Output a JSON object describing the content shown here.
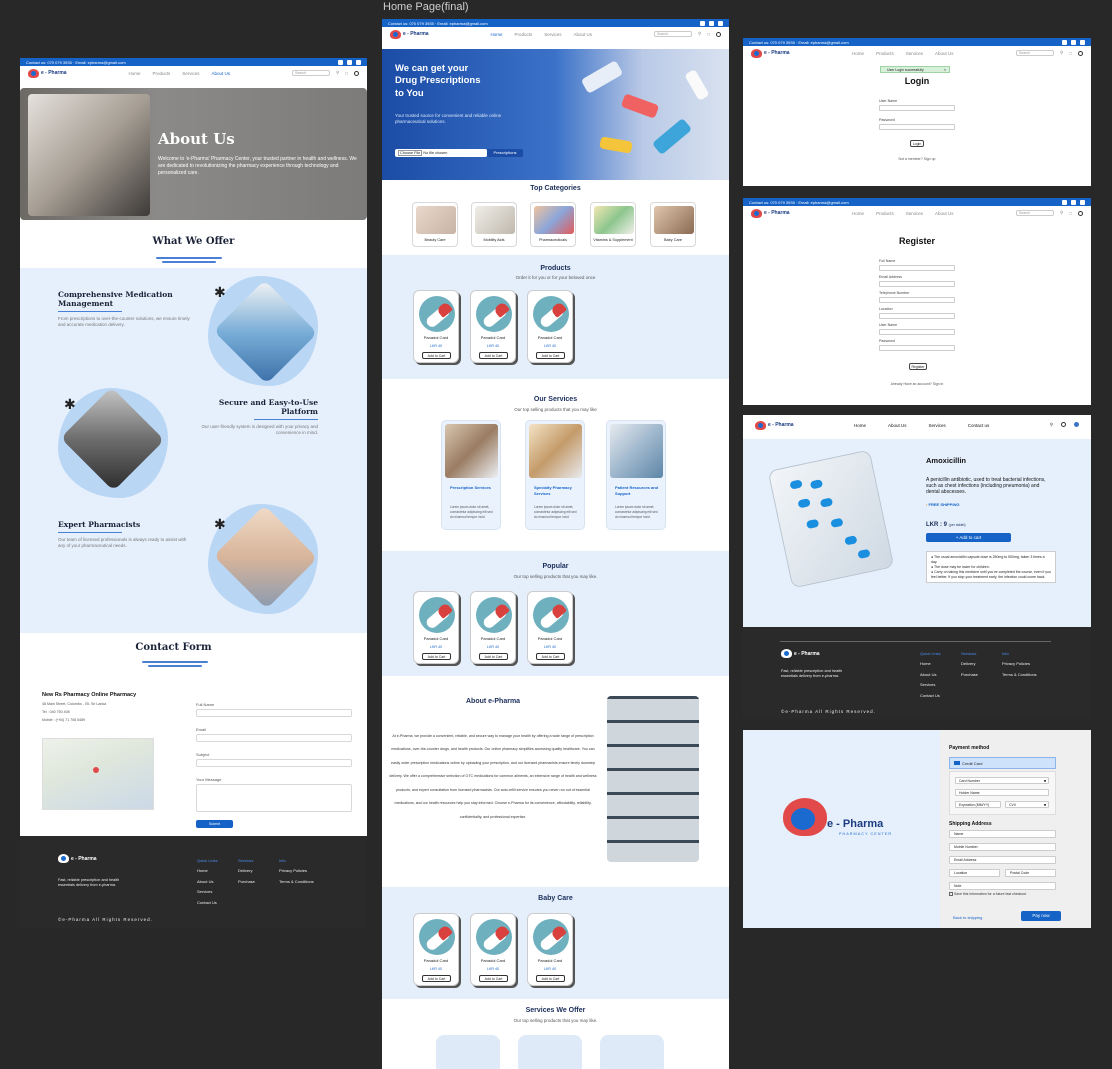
{
  "frame_title": "Home Page(final)",
  "topbar": {
    "contact": "Contact us: 070 079 3935 · Email: epharma@gmail.com"
  },
  "nav": {
    "home": "Home",
    "products": "Products",
    "services": "Services",
    "about": "About Us",
    "search_placeholder": "Search"
  },
  "brand": {
    "name": "e - Pharma",
    "sub": "PHARMACY CENTER"
  },
  "about_page": {
    "hero_title": "About Us",
    "hero_text": "Welcome to 'e-Pharma' Pharmacy Center, your trusted partner in health and wellness. We are dedicated to revolutionizing the pharmacy experience through technology and personalized care.",
    "offer_title": "What We Offer",
    "features": [
      {
        "title": "Comprehensive Medication Management",
        "text": "From prescriptions to over-the-counter solutions, we ensure timely and accurate medication delivery."
      },
      {
        "title": "Secure and Easy-to-Use Platform",
        "text": "Our user-friendly system is designed with your privacy and convenience in mind."
      },
      {
        "title": "Expert Pharmacists",
        "text": "Our team of licensed professionals is always ready to assist with any of your pharmaceutical needs."
      }
    ],
    "contact_title": "Contact Form",
    "pharmacy_name": "New Rs Pharmacy Online Pharmacy",
    "address": "48 Main Street, Colombo - 05, Sri Lanka",
    "tel": "Tel : 040 750 408",
    "mobile": "Mobile : (+94) 71 708 5489",
    "form": {
      "full_name": "Full Name",
      "email": "Email",
      "subject": "Subject",
      "message": "Your Message",
      "submit": "Submit"
    }
  },
  "footer": {
    "tagline": "Fast, reliable prescription and health essentials delivery from e-pharma.",
    "quick_links": "Quick Links",
    "services": "Services",
    "info": "Info",
    "ql": [
      "Home",
      "About Us",
      "Services",
      "Contact Us"
    ],
    "sv": [
      "Delivery",
      "Purchase"
    ],
    "inf": [
      "Privacy Policies",
      "Terms & Conditions"
    ],
    "copyright": "©e-Pharma All Rights Reserved."
  },
  "home_page": {
    "hero_title_1": "We can get your",
    "hero_title_2": "Drug Prescriptions",
    "hero_title_3": "to You",
    "hero_text": "Your trusted source for convenient and reliable online pharmaceutical solutions.",
    "choose_file": "Choose File",
    "no_file": "No file chosen",
    "prescriptions_btn": "Prescriptions",
    "top_categories": "Top Categories",
    "categories": [
      "Beauty Care",
      "Mobility Aids",
      "Pharmaceuticals",
      "Vitamins & Supplement",
      "Baby Care"
    ],
    "products_title": "Products",
    "products_sub": "Order it for you or for your beloved once",
    "product_name": "Panadol Card",
    "product_price": "LKR 40",
    "add_to_cart": "Add to Cart",
    "services_title": "Our Services",
    "services_sub": "Our top selling products that you may like",
    "services": [
      {
        "title": "Prescription Services",
        "text": "Lorem ipsum dolor sit amet, consectetur adipiscing elit sed do eiusmod tempor incid"
      },
      {
        "title": "Specialty Pharmacy Services",
        "text": "Lorem ipsum dolor sit amet, consectetur adipiscing elit sed do eiusmod tempor incid"
      },
      {
        "title": "Patient Resources and Support",
        "text": "Lorem ipsum dolor sit amet, consectetur adipiscing elit sed do eiusmod tempor incid"
      }
    ],
    "popular_title": "Popular",
    "popular_sub": "Our top selling products that you may like.",
    "about_title": "About e-Pharma",
    "about_text": "At e-Pharma, we provide a convenient, reliable, and secure way to manage your health by offering a wide range of prescription medications, over-the-counter drugs, and health products. Our online pharmacy simplifies accessing quality healthcare. You can easily order prescription medications online by uploading your prescription, and our licensed pharmacists ensure timely doorstep delivery. We offer a comprehensive selection of OTC medications for common ailments, an extensive range of health and wellness products, and expert consultation from licensed pharmacists. Our auto-refill service ensures you never run out of essential medications, and our health resources help you stay informed. Choose e-Pharma for its convenience, affordability, reliability, confidentiality, and professional expertise.",
    "baby_title": "Baby Care",
    "services_offer_title": "Services We Offer",
    "services_offer_sub": "Our top selling products that you may like."
  },
  "login": {
    "title": "Login",
    "toast": "User Login successfully",
    "label1": "User Name",
    "label2": "Password",
    "btn": "Login",
    "link": "Not a member? Sign up"
  },
  "register": {
    "title": "Register",
    "fields": [
      "Full Name",
      "Email Address",
      "Telephone Number",
      "Location",
      "User Name",
      "Password"
    ],
    "btn": "Register",
    "link": "Already Have an account? Sign in"
  },
  "product_page": {
    "nav": [
      "Home",
      "About Us",
      "Services",
      "Contact us"
    ],
    "name": "Amoxicillin",
    "desc": "A penicillin antibiotic, used to treat bacterial infections, such as chest infections (including pneumonia) and dental abscesses.",
    "shipping": "FREE SHIPPING",
    "price": "LKR : 9",
    "per": "(per tablet)",
    "add": "+ Add to cart",
    "notes": [
      "The usual amoxicillin capsule dose is 250mg to 500mg, taken 3 times a day.",
      "The dose may be lower for children.",
      "Carry on taking this medicine until you've completed the course, even if you feel better. If you stop your treatment early, the infection could come back."
    ]
  },
  "payment": {
    "method": "Payment method",
    "credit": "Credit Card",
    "card": "Card Number",
    "holder": "Holder Name",
    "exp": "Expiration (MM/YY)",
    "cvv": "CVV",
    "shipping": "Shipping Address",
    "name": "Name",
    "mobile": "Mobile Number",
    "email": "Email Address",
    "location": "Location",
    "postal": "Postal Code",
    "note": "Note",
    "save": "Save this information for a future fast checkout",
    "back": "Back to shipping",
    "pay": "Pay now"
  }
}
